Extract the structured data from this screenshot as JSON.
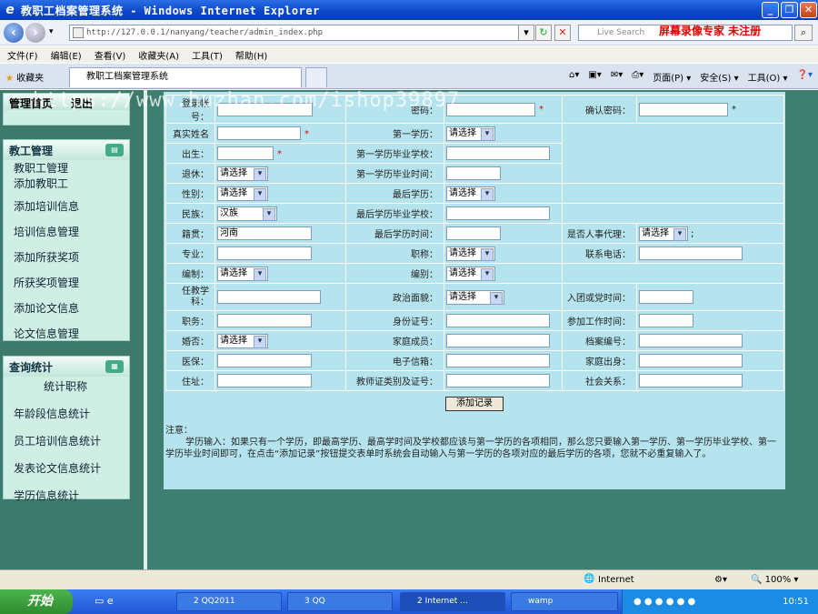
{
  "window": {
    "title": "教职工档案管理系统 - Windows Internet Explorer"
  },
  "address": {
    "url": "http://127.0.0.1/nanyang/teacher/admin_index.php",
    "search_placeholder": "Live Search",
    "recorder_text": "屏幕录像专家 未注册"
  },
  "menu": [
    "文件(F)",
    "编辑(E)",
    "查看(V)",
    "收藏夹(A)",
    "工具(T)",
    "帮助(H)"
  ],
  "tabs": {
    "favorites": "收藏夹",
    "active": "教职工档案管理系统"
  },
  "toolbar": [
    "页面(P) ▾",
    "安全(S) ▾",
    "工具(O) ▾"
  ],
  "sidebar": {
    "top_items": [
      "管理首页",
      "退出"
    ],
    "teacher_mgmt": {
      "title": "教工管理",
      "items": [
        "教职工管理",
        "添加教职工",
        "添加培训信息",
        "培训信息管理",
        "添加所获奖项",
        "所获奖项管理",
        "添加论文信息",
        "论文信息管理"
      ]
    },
    "stats": {
      "title": "查询统计",
      "items": [
        "统计职称",
        "年龄段信息统计",
        "员工培训信息统计",
        "发表论文信息统计",
        "学历信息统计"
      ]
    }
  },
  "form": {
    "labels": {
      "username": "登录帐号：",
      "password": "密码：",
      "confirm": "确认密码：",
      "realname": "真实姓名",
      "edu1": "第一学历：",
      "birth": "出生：",
      "edu1_school": "第一学历毕业学校：",
      "retired": "退休：",
      "edu1_time": "第一学历毕业时间：",
      "gender": "性别：",
      "last_edu": "最后学历：",
      "ethnic": "民族：",
      "last_school": "最后学历毕业学校：",
      "native": "籍贯：",
      "last_time": "最后学历时间：",
      "agent": "是否人事代理：",
      "major": "专业：",
      "title": "职称：",
      "phone": "联系电话：",
      "staffing": "编制：",
      "category": "编别：",
      "subject": "任教学科：",
      "politics": "政治面貌：",
      "party_time": "入团或党时间：",
      "position": "职务：",
      "idcard": "身份证号：",
      "work_time": "参加工作时间：",
      "marriage": "婚否：",
      "family": "家庭成员：",
      "archive_no": "档案编号：",
      "insurance": "医保：",
      "email": "电子信箱：",
      "origin": "家庭出身：",
      "address": "住址：",
      "cert": "教师证类别及证号：",
      "social": "社会关系："
    },
    "values": {
      "ethnic": "汉族",
      "native": "河南",
      "select_default": "请选择"
    },
    "required_mark": "*",
    "submit": "添加记录"
  },
  "notes": {
    "title": "注意：",
    "body": "学历输入：如果只有一个学历，即最高学历、最高学时间及学校都应该与第一学历的各项相同，那么您只要输入第一学历、第一学历毕业学校、第一学历毕业时间即可，在点击“添加记录”按钮提交表单时系统会自动输入与第一学历的各项对应的最后学历的各项，您就不必重复输入了。"
  },
  "watermark": "https://www.huzhan.com/ishop39897",
  "status": {
    "zone": "Internet",
    "zoom": "100%"
  },
  "taskbar": {
    "start": "开始",
    "items": [
      "2 QQ2011",
      "3 QQ",
      "2 Internet ...",
      "wamp"
    ],
    "clock": "10:51"
  }
}
